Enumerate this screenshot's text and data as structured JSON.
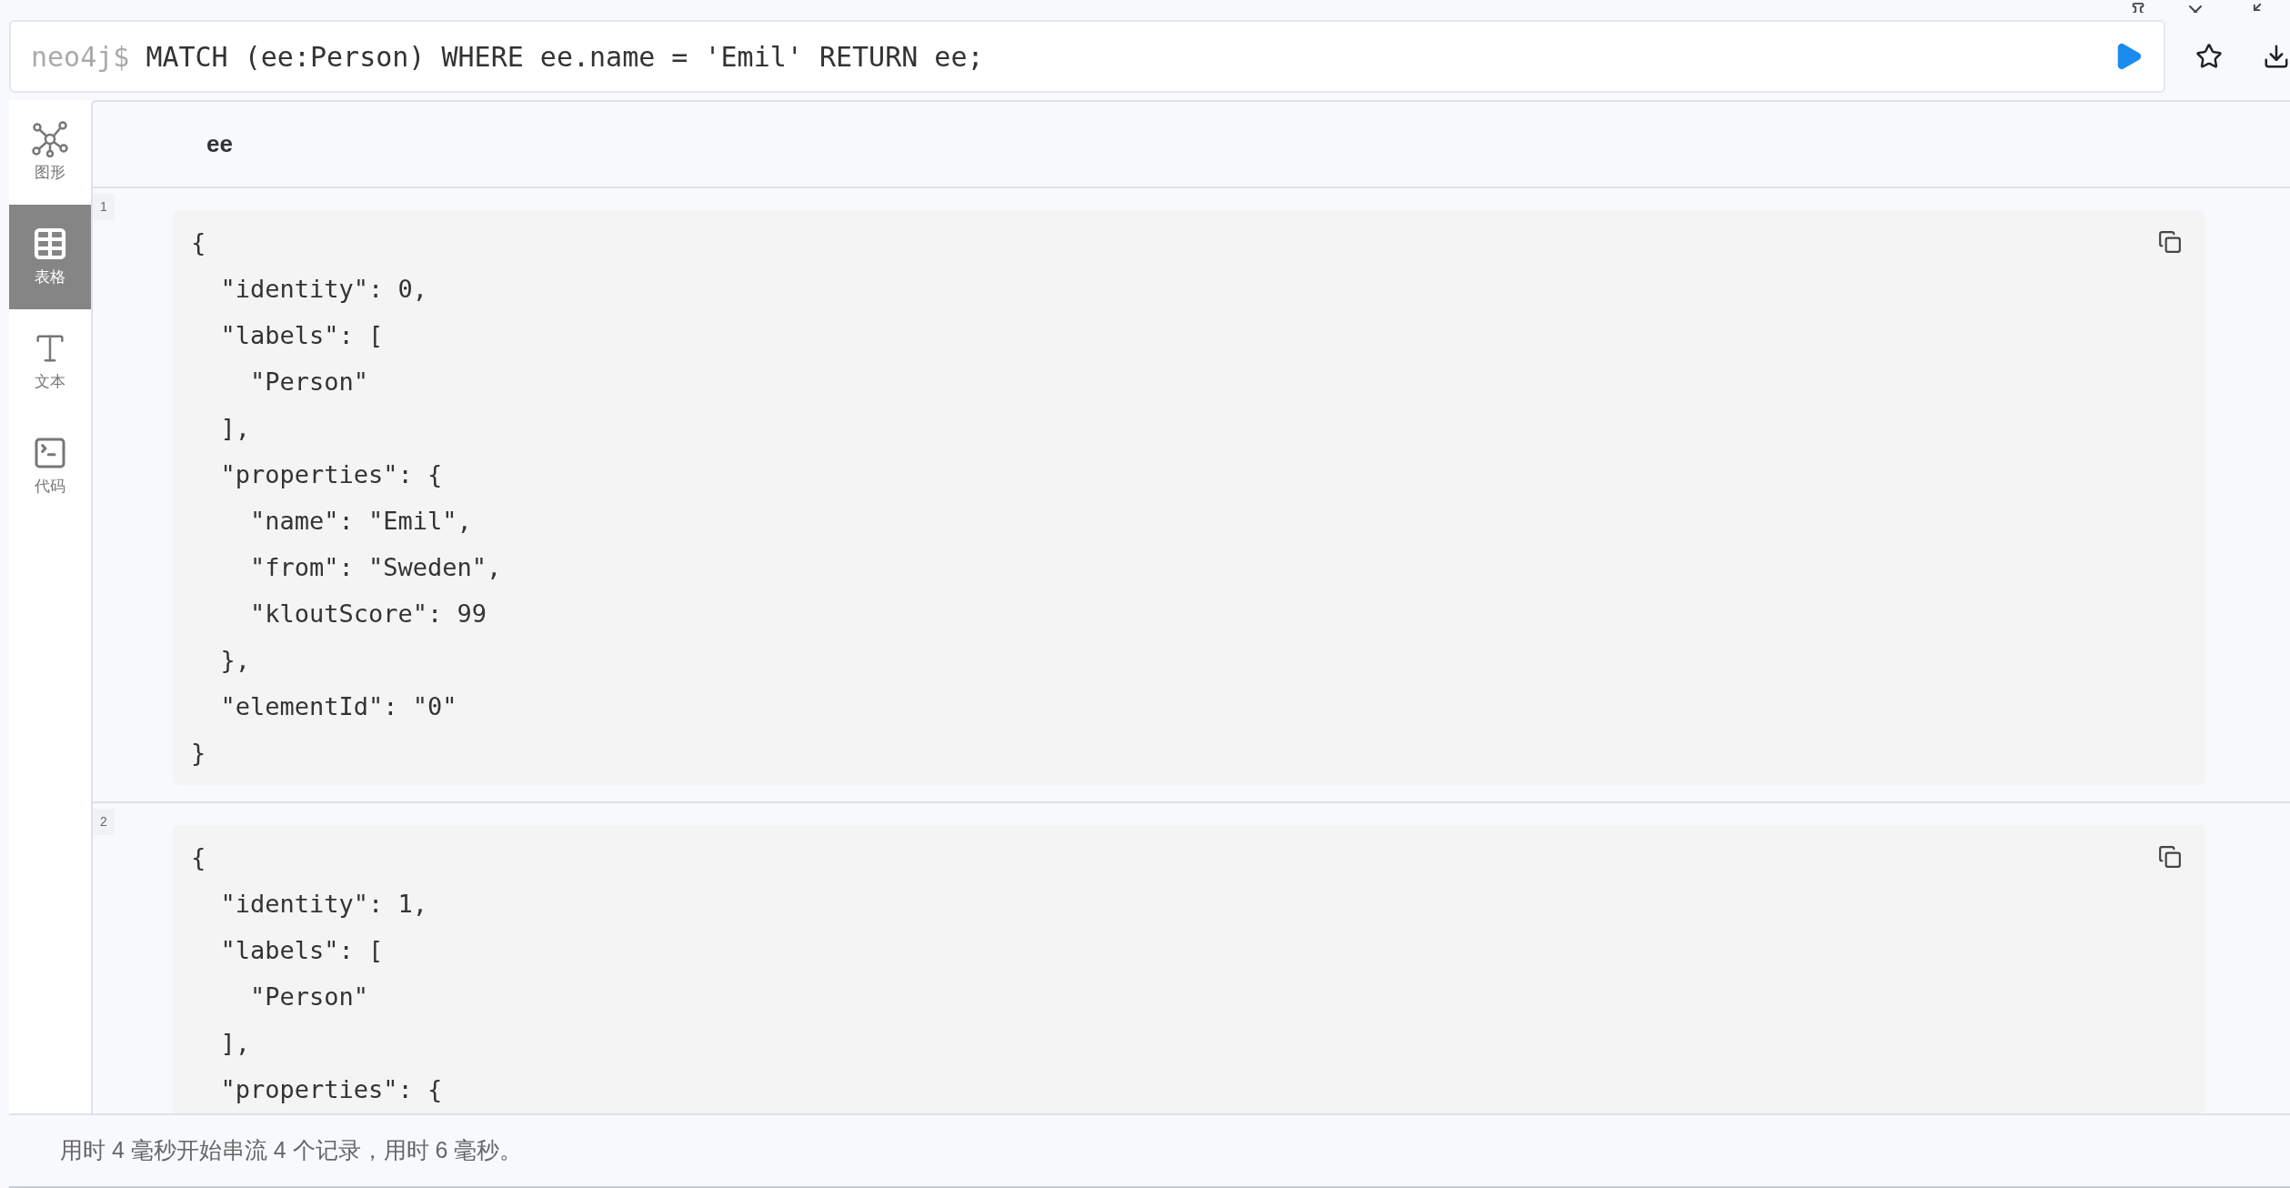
{
  "editor": {
    "prompt": "neo4j$",
    "query": "MATCH (ee:Person) WHERE ee.name = 'Emil' RETURN ee;"
  },
  "sidebar": {
    "items": [
      {
        "kind": "graph",
        "label": "图形",
        "selected": false
      },
      {
        "kind": "table",
        "label": "表格",
        "selected": true
      },
      {
        "kind": "text",
        "label": "文本",
        "selected": false
      },
      {
        "kind": "code",
        "label": "代码",
        "selected": false
      }
    ]
  },
  "table": {
    "columns": [
      "ee"
    ],
    "rows": [
      {
        "index": "1",
        "lines": [
          "{",
          "  \"identity\": 0,",
          "  \"labels\": [",
          "    \"Person\"",
          "  ],",
          "  \"properties\": {",
          "    \"name\": \"Emil\",",
          "    \"from\": \"Sweden\",",
          "    \"kloutScore\": 99",
          "  },",
          "  \"elementId\": \"0\"",
          "}"
        ]
      },
      {
        "index": "2",
        "lines": [
          "{",
          "  \"identity\": 1,",
          "  \"labels\": [",
          "    \"Person\"",
          "  ],",
          "  \"properties\": {"
        ]
      }
    ]
  },
  "status_bar": "用时 4 毫秒开始串流 4 个记录，用时 6 毫秒。"
}
